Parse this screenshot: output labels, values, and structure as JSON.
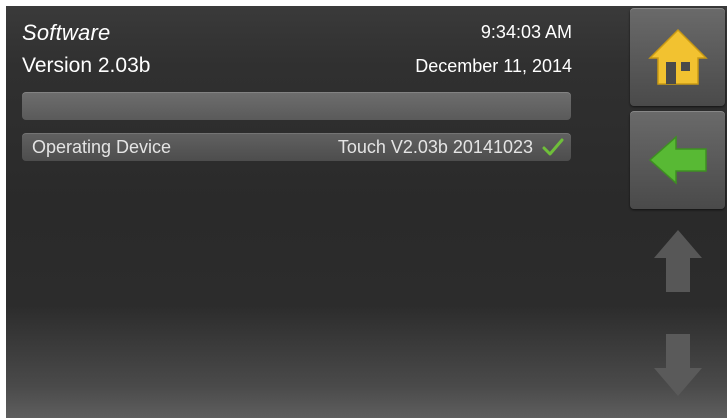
{
  "header": {
    "title": "Software",
    "version": "Version 2.03b",
    "time": "9:34:03 AM",
    "date": "December 11, 2014"
  },
  "progress": {
    "value": 0
  },
  "device_row": {
    "label": "Operating Device",
    "value": "Touch V2.03b 20141023",
    "status_icon": "check-icon",
    "status_color": "#6fbf3a"
  },
  "side_panel": {
    "home_icon": "home-icon",
    "home_color": "#f2c230",
    "back_icon": "back-arrow-icon",
    "back_color": "#58b934",
    "up_icon": "arrow-up-icon",
    "down_icon": "arrow-down-icon",
    "arrow_color": "#5a5a5a"
  }
}
